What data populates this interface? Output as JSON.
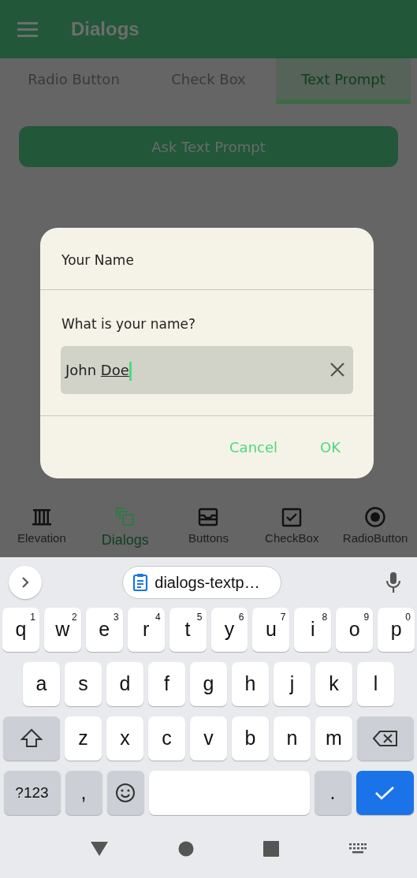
{
  "app_bar": {
    "title": "Dialogs"
  },
  "tabs": [
    {
      "label": "Radio Button",
      "selected": false
    },
    {
      "label": "Check Box",
      "selected": false
    },
    {
      "label": "Text Prompt",
      "selected": true
    }
  ],
  "action_button": {
    "label": "Ask Text Prompt"
  },
  "dialog": {
    "title": "Your Name",
    "message": "What is your name?",
    "field": {
      "value": "John",
      "composing": "Doe"
    },
    "buttons": [
      "Cancel",
      "OK"
    ]
  },
  "bottom_nav": [
    {
      "label": "Elevation",
      "kind": "columns",
      "selected": false
    },
    {
      "label": "Dialogs",
      "kind": "stack",
      "selected": true
    },
    {
      "label": "Buttons",
      "kind": "tray",
      "selected": false
    },
    {
      "label": "CheckBox",
      "kind": "checkbox",
      "selected": false
    },
    {
      "label": "RadioButton",
      "kind": "radio",
      "selected": false
    }
  ],
  "keyboard": {
    "suggestion": "dialogs-textp…",
    "rows": [
      {
        "keys": [
          {
            "kind": "letter",
            "label": "q",
            "hint": "1"
          },
          {
            "kind": "letter",
            "label": "w",
            "hint": "2"
          },
          {
            "kind": "letter",
            "label": "e",
            "hint": "3"
          },
          {
            "kind": "letter",
            "label": "r",
            "hint": "4"
          },
          {
            "kind": "letter",
            "label": "t",
            "hint": "5"
          },
          {
            "kind": "letter",
            "label": "y",
            "hint": "6"
          },
          {
            "kind": "letter",
            "label": "u",
            "hint": "7"
          },
          {
            "kind": "letter",
            "label": "i",
            "hint": "8"
          },
          {
            "kind": "letter",
            "label": "o",
            "hint": "9"
          },
          {
            "kind": "letter",
            "label": "p",
            "hint": "0"
          }
        ]
      },
      {
        "keys": [
          {
            "kind": "letter",
            "label": "a"
          },
          {
            "kind": "letter",
            "label": "s"
          },
          {
            "kind": "letter",
            "label": "d"
          },
          {
            "kind": "letter",
            "label": "f"
          },
          {
            "kind": "letter",
            "label": "g"
          },
          {
            "kind": "letter",
            "label": "h"
          },
          {
            "kind": "letter",
            "label": "j"
          },
          {
            "kind": "letter",
            "label": "k"
          },
          {
            "kind": "letter",
            "label": "l"
          }
        ]
      },
      {
        "keys": [
          {
            "kind": "shift"
          },
          {
            "kind": "letter",
            "label": "z"
          },
          {
            "kind": "letter",
            "label": "x"
          },
          {
            "kind": "letter",
            "label": "c"
          },
          {
            "kind": "letter",
            "label": "v"
          },
          {
            "kind": "letter",
            "label": "b"
          },
          {
            "kind": "letter",
            "label": "n"
          },
          {
            "kind": "letter",
            "label": "m"
          },
          {
            "kind": "backspace"
          }
        ]
      },
      {
        "keys": [
          {
            "kind": "mode",
            "label": "?123"
          },
          {
            "kind": "symbol",
            "label": ","
          },
          {
            "kind": "emoji"
          },
          {
            "kind": "space"
          },
          {
            "kind": "symbol",
            "label": "."
          },
          {
            "kind": "enter"
          }
        ]
      }
    ]
  }
}
